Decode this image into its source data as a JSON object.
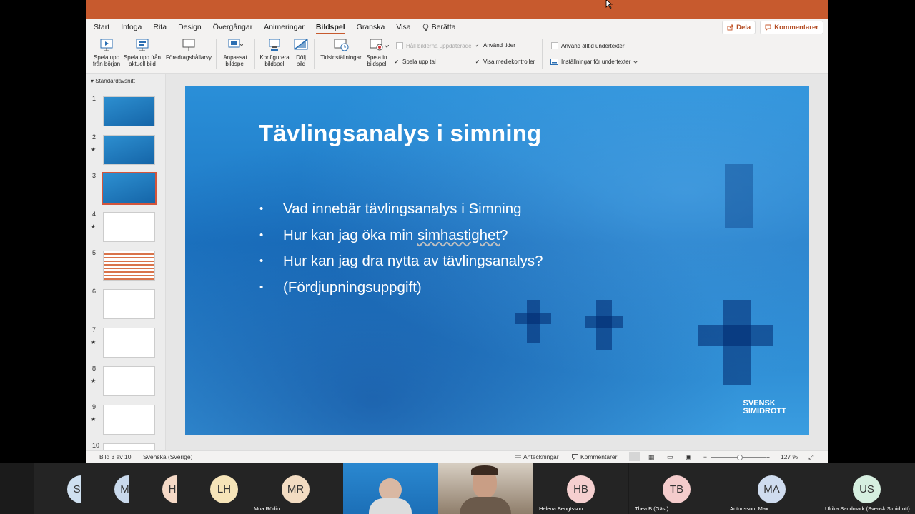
{
  "menu": {
    "tabs": [
      "Start",
      "Infoga",
      "Rita",
      "Design",
      "Övergångar",
      "Animeringar",
      "Bildspel",
      "Granska",
      "Visa"
    ],
    "active_tab": "Bildspel",
    "tell": "Berätta",
    "share": "Dela",
    "comments": "Kommentarer"
  },
  "ribbon": {
    "play_start": "Spela upp\nfrån början",
    "play_current": "Spela upp från\naktuell bild",
    "presenter_view": "Föredragshållarvy",
    "custom_show": "Anpassat\nbildspel",
    "setup_show": "Konfigurera\nbildspel",
    "hide_slide": "Dölj\nbild",
    "rehearse": "Tidsinställningar",
    "record": "Spela in\nbildspel",
    "keep_updated": "Håll bilderna uppdaterade",
    "play_narration": "Spela upp tal",
    "use_timings": "Använd tider",
    "show_media": "Visa mediekontroller",
    "always_subtitles": "Använd alltid undertexter",
    "subtitle_settings": "Inställningar för undertexter"
  },
  "sidebar": {
    "section": "Standardavsnitt",
    "slides": [
      "1",
      "2",
      "3",
      "4",
      "5",
      "6",
      "7",
      "8",
      "9",
      "10"
    ],
    "star": "★"
  },
  "slide": {
    "title": "Tävlingsanalys i simning",
    "bullet_char": "•",
    "bullets": [
      "Vad innebär tävlingsanalys i Simning",
      "Hur kan jag öka min simhastighet?",
      "Hur kan jag dra nytta av tävlingsanalys?",
      "(Fördjupningsuppgift)"
    ],
    "brand_line1": "SVENSK",
    "brand_line2": "SIMIDROTT"
  },
  "status": {
    "slide_count": "Bild 3 av 10",
    "language": "Svenska (Sverige)",
    "notes": "Anteckningar",
    "comments": "Kommentarer",
    "zoom": "127 %"
  },
  "participants": [
    {
      "initials": "SO",
      "name": "",
      "color": "#cfe0f0"
    },
    {
      "initials": "MB",
      "name": "",
      "color": "#c9d9ec"
    },
    {
      "initials": "HH",
      "name": "",
      "color": "#f5d9c6"
    },
    {
      "initials": "LH",
      "name": "",
      "color": "#f6e4b8"
    },
    {
      "initials": "MR",
      "name": "Moa Rödin",
      "color": "#f3dcc2"
    },
    {
      "initials": "",
      "name": "",
      "color": ""
    },
    {
      "initials": "",
      "name": "",
      "color": ""
    },
    {
      "initials": "HB",
      "name": "Helena Bengtsson",
      "color": "#f5cfcf"
    },
    {
      "initials": "TB",
      "name": "Thea B (Gäst)",
      "color": "#f4cccc"
    },
    {
      "initials": "MA",
      "name": "Antonsson, Max",
      "color": "#cfdcef"
    },
    {
      "initials": "US",
      "name": "Ulrika Sandmark (Svensk Simidrott)",
      "color": "#d6efe0"
    }
  ]
}
